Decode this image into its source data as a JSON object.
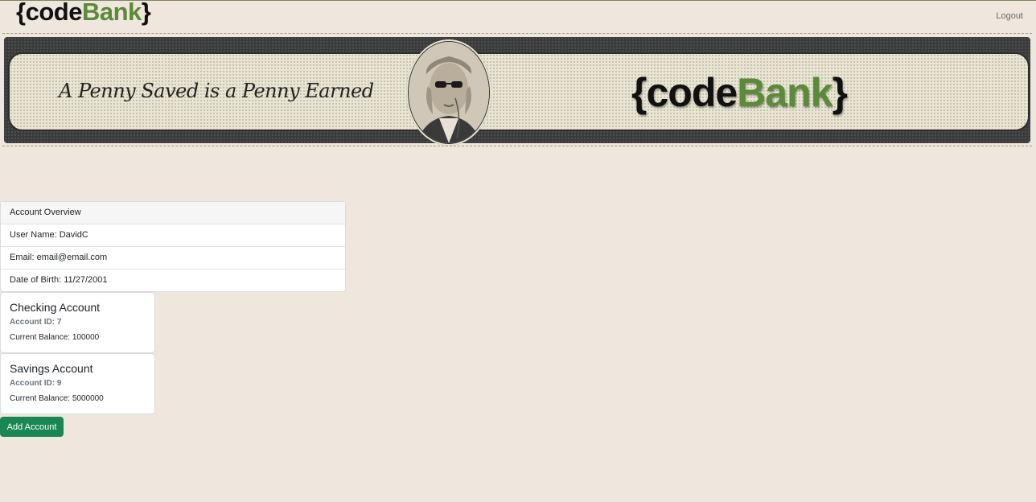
{
  "navbar": {
    "logo": {
      "open": "{",
      "code": "code",
      "bank": "Bank",
      "close": "}"
    },
    "logout_label": "Logout"
  },
  "banner": {
    "slogan": "A Penny Saved is a Penny Earned",
    "logo": {
      "open": "{",
      "code": "code",
      "bank": "Bank",
      "close": "}"
    }
  },
  "overview": {
    "header": "Account Overview",
    "rows": [
      "User Name: DavidC",
      "Email: email@email.com",
      "Date of Birth: 11/27/2001"
    ]
  },
  "accounts": [
    {
      "title": "Checking Account",
      "id_text": "Account ID: 7",
      "balance_text": "Current Balance: 100000"
    },
    {
      "title": "Savings Account",
      "id_text": "Account ID: 9",
      "balance_text": "Current Balance: 5000000"
    }
  ],
  "add_account_label": "Add Account",
  "colors": {
    "brand_green": "#5a8a3a",
    "button_green": "#198754",
    "background": "#efe6dd"
  }
}
